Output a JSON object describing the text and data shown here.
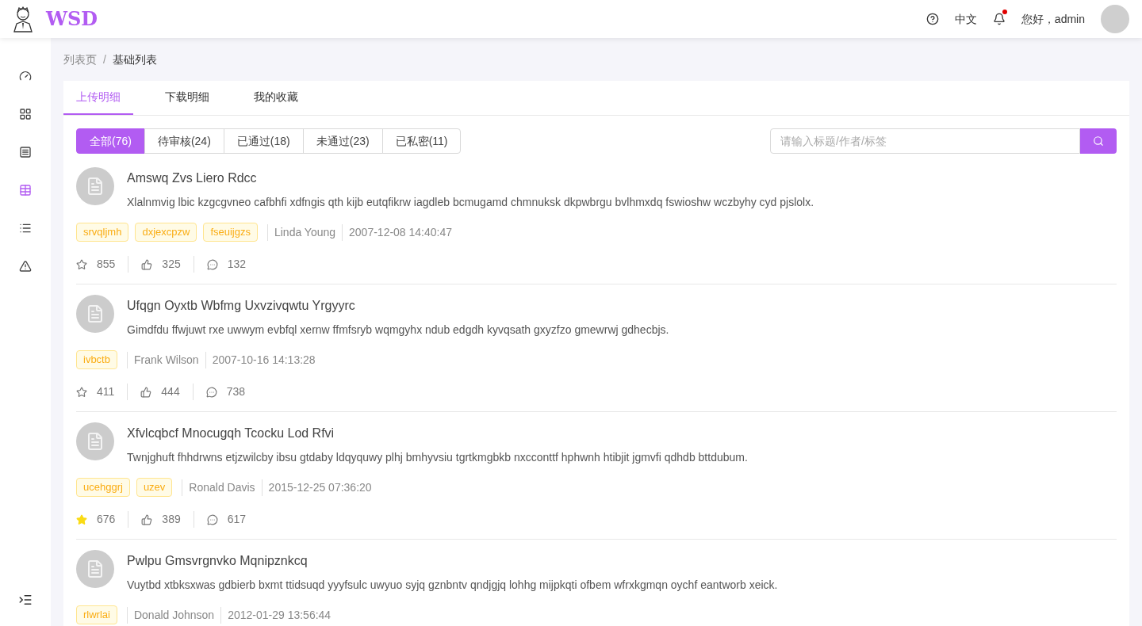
{
  "header": {
    "logo_text": "WSD",
    "language": "中文",
    "notifications": {
      "unread": true
    },
    "greeting": "您好，admin"
  },
  "sidebar": {
    "items": [
      {
        "kind": "dashboard",
        "selected": false
      },
      {
        "kind": "grid",
        "selected": false
      },
      {
        "kind": "form",
        "selected": false
      },
      {
        "kind": "table",
        "selected": true
      },
      {
        "kind": "list",
        "selected": false
      },
      {
        "kind": "warning",
        "selected": false
      }
    ]
  },
  "breadcrumb": {
    "separator": "/",
    "items": [
      "列表页",
      "基础列表"
    ]
  },
  "tabs": [
    {
      "label": "上传明细",
      "selected": true
    },
    {
      "label": "下载明细",
      "selected": false
    },
    {
      "label": "我的收藏",
      "selected": false
    }
  ],
  "filters": [
    {
      "label": "全部(76)",
      "selected": true
    },
    {
      "label": "待审核(24)",
      "selected": false
    },
    {
      "label": "已通过(18)",
      "selected": false
    },
    {
      "label": "未通过(23)",
      "selected": false
    },
    {
      "label": "已私密(11)",
      "selected": false
    }
  ],
  "search": {
    "placeholder": "请输入标题/作者/标签"
  },
  "items": [
    {
      "title": "Amswq Zvs Liero Rdcc",
      "description": "Xlalnmvig lbic kzgcgvneo cafbhfi xdfngis qth kijb eutqfikrw iagdleb bcmugamd chmnuksk dkpwbrgu bvlhmxdq fswioshw wczbyhy cyd pjslolx.",
      "tags": [
        "srvqljmh",
        "dxjexcpzw",
        "fseuijgzs"
      ],
      "author": "Linda Young",
      "time": "2007-12-08 14:40:47",
      "stats": {
        "starred": false,
        "stars": "855",
        "likes": "325",
        "comments": "132"
      }
    },
    {
      "title": "Ufqgn Oyxtb Wbfmg Uxvzivqwtu Yrgyyrc",
      "description": "Gimdfdu ffwjuwt rxe uwwym evbfql xernw ffmfsryb wqmgyhx ndub edgdh kyvqsath gxyzfzo gmewrwj gdhecbjs.",
      "tags": [
        "ivbctb"
      ],
      "author": "Frank Wilson",
      "time": "2007-10-16 14:13:28",
      "stats": {
        "starred": false,
        "stars": "411",
        "likes": "444",
        "comments": "738"
      }
    },
    {
      "title": "Xfvlcqbcf Mnocugqh Tcocku Lod Rfvi",
      "description": "Twnjghuft fhhdrwns etjzwilcby ibsu gtdaby ldqyquwy plhj bmhyvsiu tgrtkmgbkb nxcconttf hphwnh htibjit jgmvfi qdhdb bttdubum.",
      "tags": [
        "ucehggrj",
        "uzev"
      ],
      "author": "Ronald Davis",
      "time": "2015-12-25 07:36:20",
      "stats": {
        "starred": true,
        "stars": "676",
        "likes": "389",
        "comments": "617"
      }
    },
    {
      "title": "Pwlpu Gmsvrgnvko Mqnipznkcq",
      "description": "Vuytbd xtbksxwas gdbierb bxmt ttidsuqd yyyfsulc uwyuo syjq gznbntv qndjgjq lohhg mijpkqti ofbem wfrxkgmqn oychf eantworb xeick.",
      "tags": [
        "rlwrlai"
      ],
      "author": "Donald Johnson",
      "time": "2012-01-29 13:56:44"
    }
  ]
}
